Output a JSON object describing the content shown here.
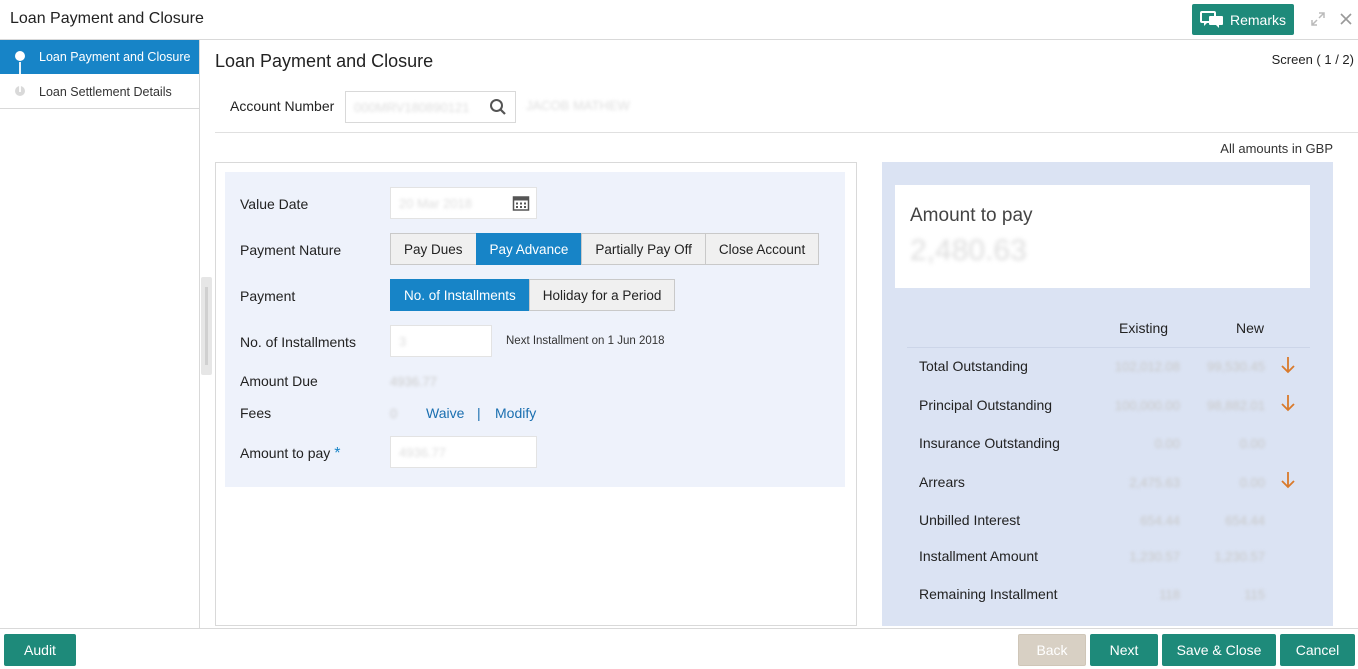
{
  "header": {
    "title": "Loan Payment and Closure",
    "remarks_label": "Remarks"
  },
  "sidebar": {
    "items": [
      {
        "label": "Loan Payment and Closure"
      },
      {
        "label": "Loan Settlement Details"
      }
    ]
  },
  "main": {
    "title": "Loan Payment and Closure",
    "screen_indicator": "Screen ( 1 / 2)",
    "account_label": "Account Number",
    "account_value": "000MRV180890121",
    "account_name": "JACOB MATHEW",
    "amount_note": "All amounts in GBP"
  },
  "form": {
    "value_date_label": "Value Date",
    "value_date": "20 Mar 2018",
    "payment_nature_label": "Payment Nature",
    "payment_nature_options": [
      "Pay Dues",
      "Pay Advance",
      "Partially Pay Off",
      "Close Account"
    ],
    "payment_nature_selected": "Pay Advance",
    "payment_label": "Payment",
    "payment_options": [
      "No. of Installments",
      "Holiday for a Period"
    ],
    "payment_selected": "No. of Installments",
    "installments_label": "No. of Installments",
    "installments_value": "3",
    "next_installment": "Next Installment on 1 Jun 2018",
    "amount_due_label": "Amount Due",
    "amount_due_value": "4936.77",
    "fees_label": "Fees",
    "fees_value": "0",
    "waive_label": "Waive",
    "separator": "|",
    "modify_label": "Modify",
    "amount_to_pay_label": "Amount to pay",
    "required_mark": "*",
    "amount_to_pay_value": "4936.77"
  },
  "summary": {
    "amount_to_pay_label": "Amount to pay",
    "amount_to_pay_value": "2,480.63",
    "col_existing": "Existing",
    "col_new": "New",
    "rows": [
      {
        "label": "Total Outstanding",
        "existing": "102,012.08",
        "new": "99,530.45",
        "arrow": true
      },
      {
        "label": "Principal Outstanding",
        "existing": "100,000.00",
        "new": "98,882.01",
        "arrow": true
      },
      {
        "label": "Insurance Outstanding",
        "existing": "0.00",
        "new": "0.00",
        "arrow": false
      },
      {
        "label": "Arrears",
        "existing": "2,475.63",
        "new": "0.00",
        "arrow": true
      },
      {
        "label": "Unbilled Interest",
        "existing": "654.44",
        "new": "654.44",
        "arrow": false
      },
      {
        "label": "Installment Amount",
        "existing": "1,230.57",
        "new": "1,230.57",
        "arrow": false
      },
      {
        "label": "Remaining Installment",
        "existing": "118",
        "new": "115",
        "arrow": false
      }
    ]
  },
  "footer": {
    "audit_label": "Audit",
    "back_label": "Back",
    "next_label": "Next",
    "save_close_label": "Save & Close",
    "cancel_label": "Cancel"
  },
  "colors": {
    "accent_blue": "#1784c7",
    "action_teal": "#1e8a7a",
    "arrow_orange": "#d97a2b",
    "summary_bg": "#dbe3f3"
  }
}
